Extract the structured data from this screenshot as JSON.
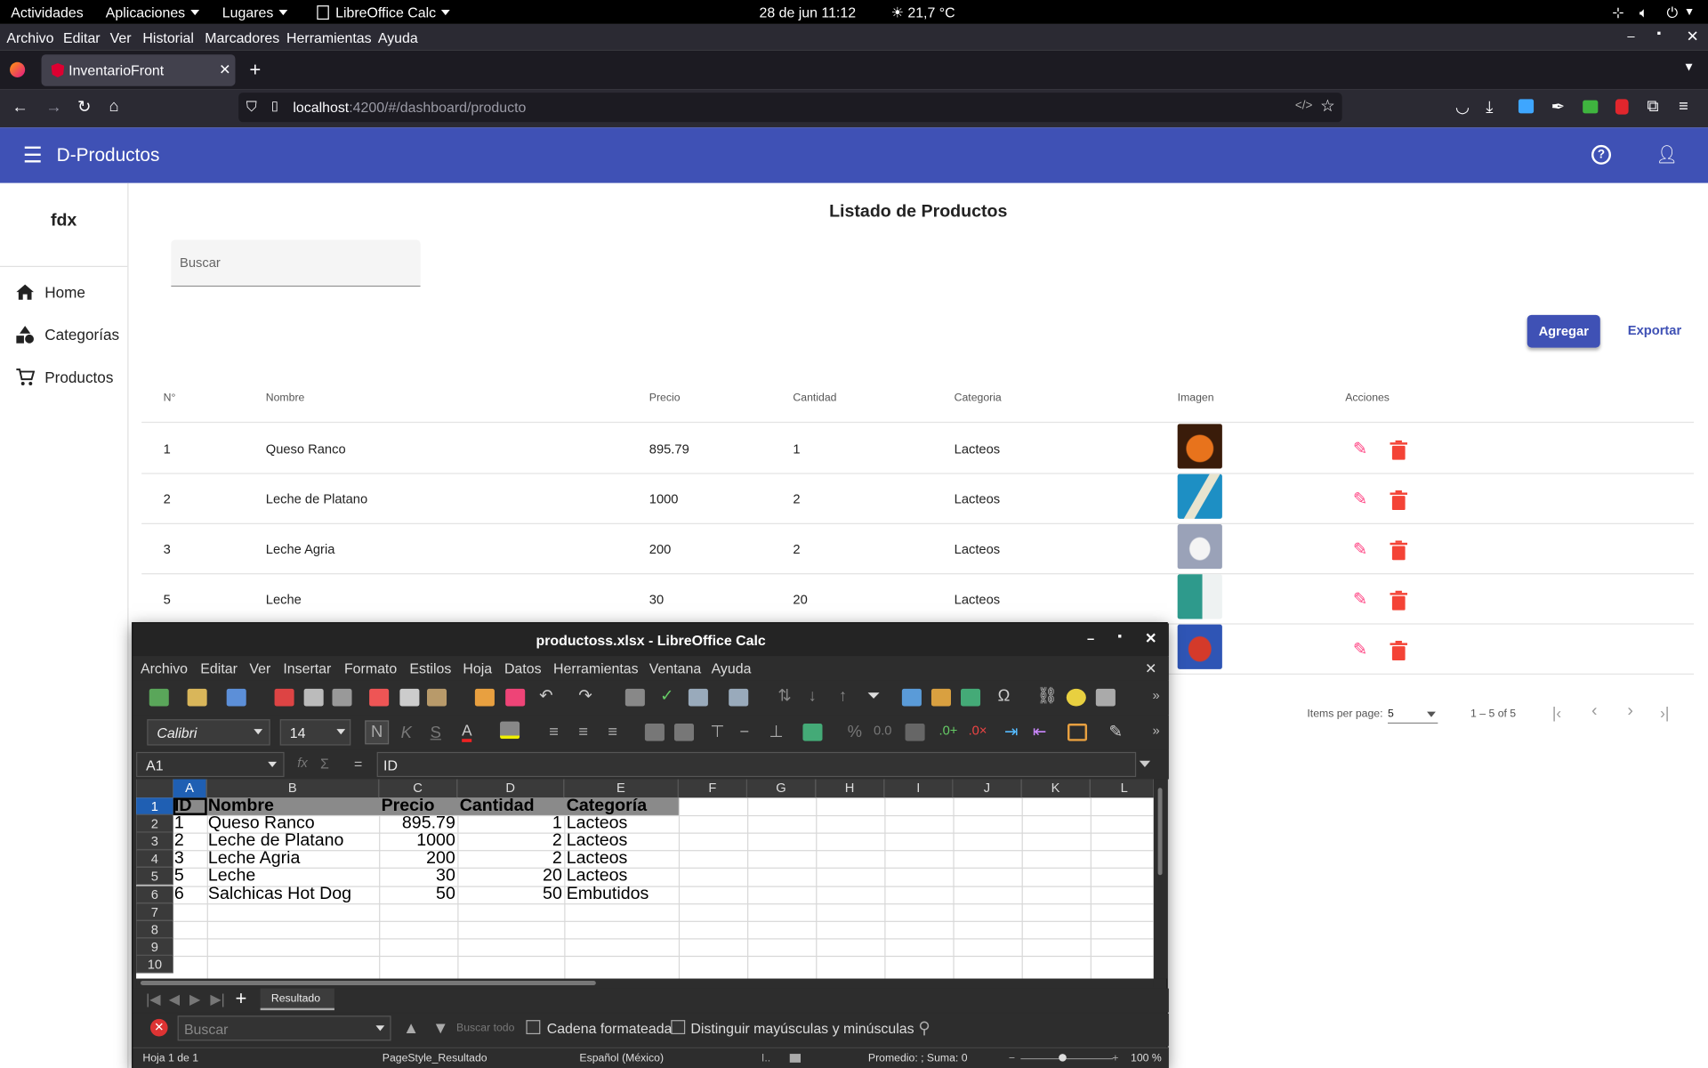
{
  "gnome": {
    "activities": "Actividades",
    "apps": "Aplicaciones",
    "places": "Lugares",
    "current_app": "LibreOffice Calc",
    "datetime": "28 de jun  11:12",
    "weather": "21,7 °C"
  },
  "firefox": {
    "menu": [
      "Archivo",
      "Editar",
      "Ver",
      "Historial",
      "Marcadores",
      "Herramientas",
      "Ayuda"
    ],
    "tab_title": "InventarioFront",
    "url_host": "localhost",
    "url_path": ":4200/#/dashboard/producto"
  },
  "app": {
    "title": "D-Productos",
    "sidebar_brand": "fdx",
    "nav": [
      {
        "label": "Home",
        "icon": "home-icon"
      },
      {
        "label": "Categorías",
        "icon": "category-icon"
      },
      {
        "label": "Productos",
        "icon": "cart-icon"
      }
    ],
    "page_title": "Listado de Productos",
    "search_placeholder": "Buscar",
    "add_label": "Agregar",
    "export_label": "Exportar",
    "columns": [
      "N°",
      "Nombre",
      "Precio",
      "Cantidad",
      "Categoria",
      "Imagen",
      "Acciones"
    ],
    "rows": [
      {
        "n": "1",
        "nombre": "Queso Ranco",
        "precio": "895.79",
        "cantidad": "1",
        "categoria": "Lacteos"
      },
      {
        "n": "2",
        "nombre": "Leche de Platano",
        "precio": "1000",
        "cantidad": "2",
        "categoria": "Lacteos"
      },
      {
        "n": "3",
        "nombre": "Leche Agria",
        "precio": "200",
        "cantidad": "2",
        "categoria": "Lacteos"
      },
      {
        "n": "5",
        "nombre": "Leche",
        "precio": "30",
        "cantidad": "20",
        "categoria": "Lacteos"
      }
    ],
    "paginator": {
      "label": "Items per page:",
      "size": "5",
      "range": "1 – 5 of 5"
    }
  },
  "calc": {
    "title": "productoss.xlsx - LibreOffice Calc",
    "menu": [
      "Archivo",
      "Editar",
      "Ver",
      "Insertar",
      "Formato",
      "Estilos",
      "Hoja",
      "Datos",
      "Herramientas",
      "Ventana",
      "Ayuda"
    ],
    "font_name": "Calibri",
    "font_size": "14",
    "bold_glyph": "N",
    "italic_glyph": "K",
    "underline_glyph": "S",
    "cell_ref": "A1",
    "formula": "ID",
    "col_headers": [
      "A",
      "B",
      "C",
      "D",
      "E",
      "F",
      "G",
      "H",
      "I",
      "J",
      "K",
      "L"
    ],
    "row_numbers": [
      "1",
      "2",
      "3",
      "4",
      "5",
      "6",
      "7",
      "8",
      "9",
      "10"
    ],
    "header_row": [
      "ID",
      "Nombre",
      "Precio",
      "Cantidad",
      "Categoría"
    ],
    "data_rows": [
      [
        "1",
        "Queso Ranco",
        "895.79",
        "1",
        "Lacteos"
      ],
      [
        "2",
        "Leche de Platano",
        "1000",
        "2",
        "Lacteos"
      ],
      [
        "3",
        "Leche Agria",
        "200",
        "2",
        "Lacteos"
      ],
      [
        "5",
        "Leche",
        "30",
        "20",
        "Lacteos"
      ],
      [
        "6",
        "Salchicas Hot Dog",
        "50",
        "50",
        "Embutidos"
      ]
    ],
    "sheet_tab": "Resultado",
    "find_placeholder": "Buscar",
    "find_all": "Buscar todo",
    "formatted": "Cadena formateada",
    "match_case": "Distinguir mayúsculas y minúsculas",
    "status": {
      "sheet": "Hoja 1 de 1",
      "style": "PageStyle_Resultado",
      "lang": "Español (México)",
      "sum": "Promedio: ; Suma: 0",
      "zoom": "100 %"
    }
  },
  "colors": {
    "primary": "#3f51b5",
    "accent": "#ff4081",
    "warn": "#f44336"
  }
}
